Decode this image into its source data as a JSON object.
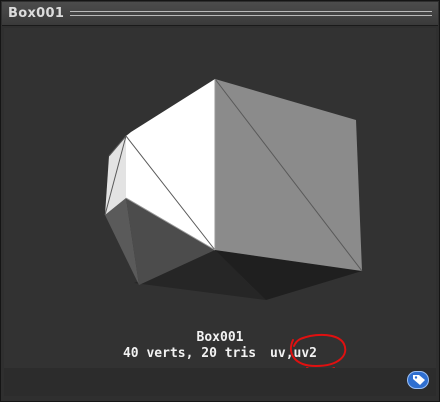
{
  "title_bar": {
    "title": "Box001"
  },
  "preview": {
    "mesh_name": "Box001",
    "stats": "40 verts, 20 tris",
    "uv_channels": "uv,uv2",
    "annotation_color": "#e01010"
  },
  "bottom_bar": {
    "label_icon": "tag-icon",
    "accent_color": "#2f6fd0"
  }
}
